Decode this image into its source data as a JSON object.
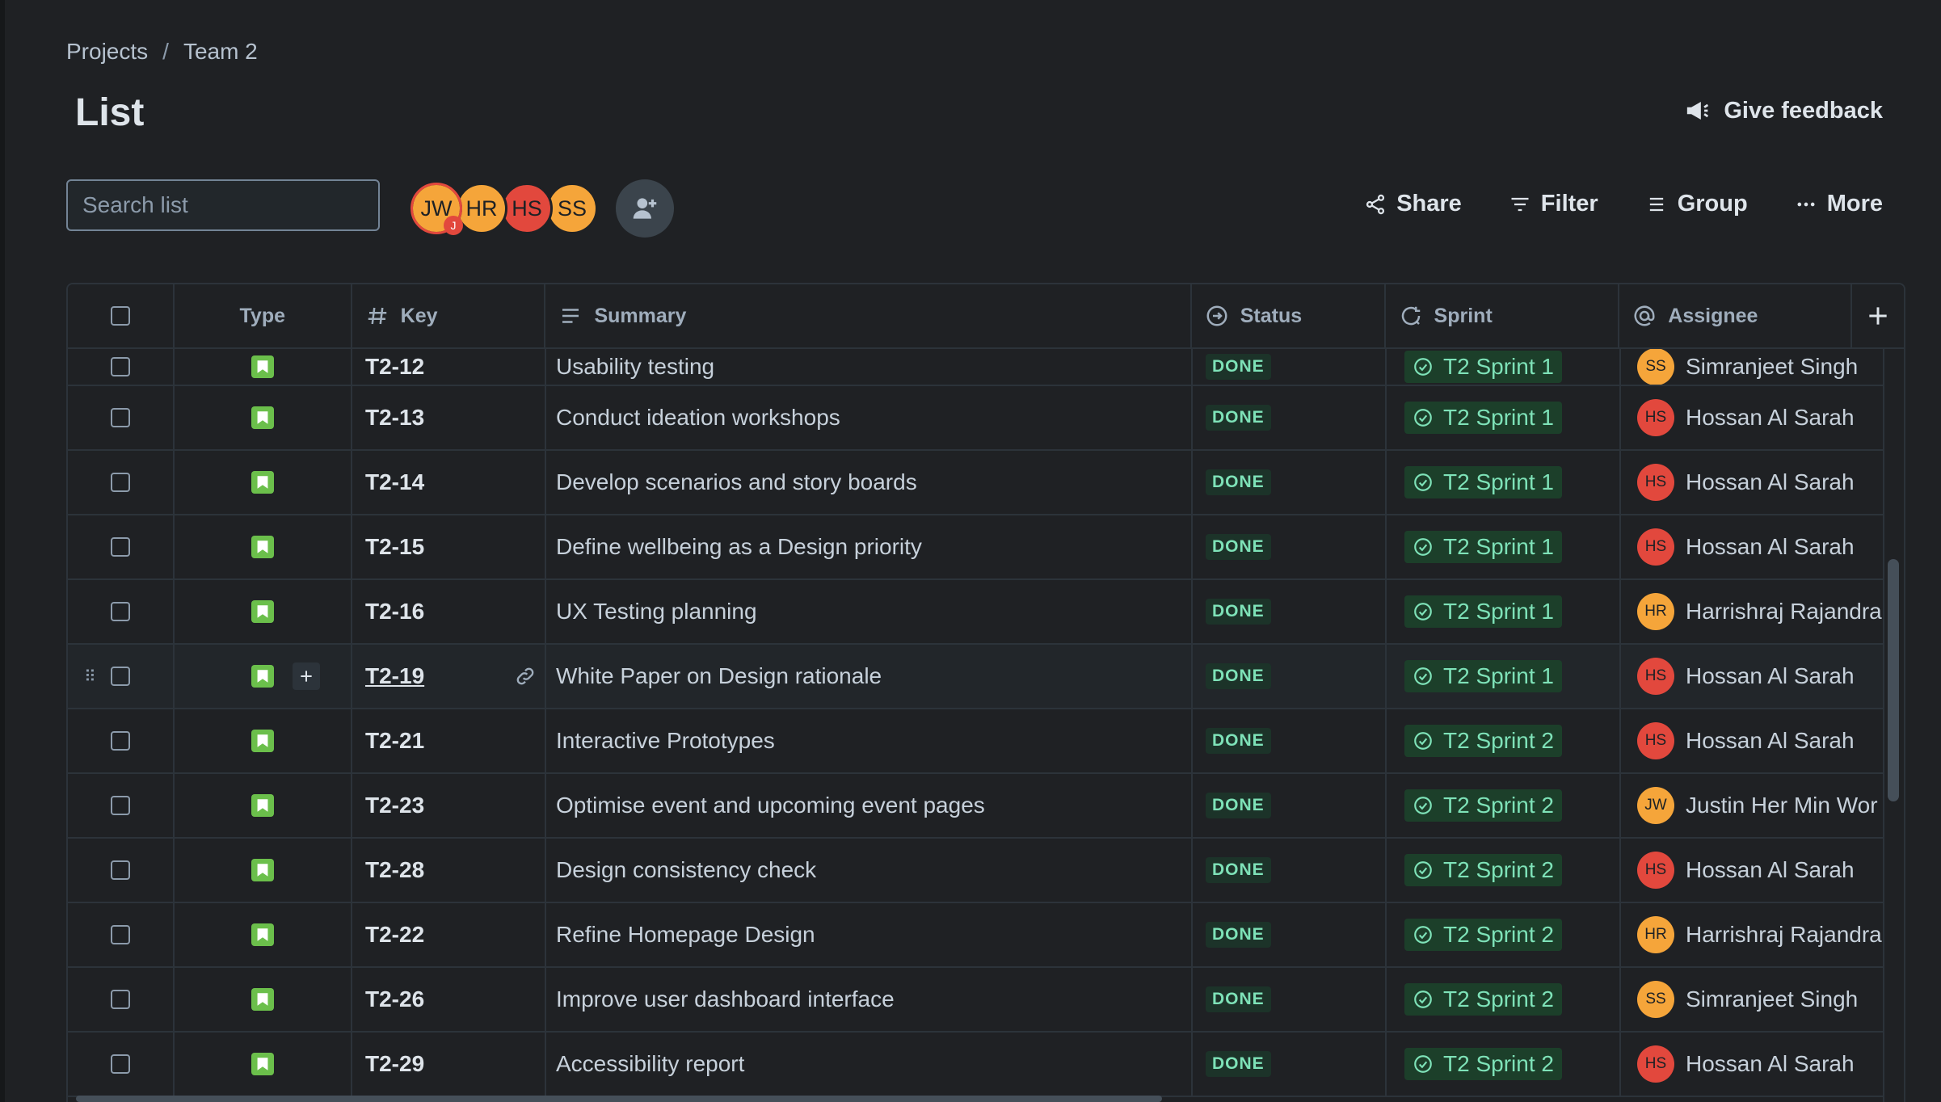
{
  "breadcrumb": {
    "items": [
      "Projects",
      "Team 2"
    ],
    "separator": "/"
  },
  "page": {
    "title": "List"
  },
  "feedback": {
    "label": "Give feedback",
    "icon": "megaphone-icon"
  },
  "search": {
    "placeholder": "Search list"
  },
  "avatars": [
    {
      "initials": "JW",
      "color": "#f5a53a",
      "badge": "J"
    },
    {
      "initials": "HR",
      "color": "#f5a53a"
    },
    {
      "initials": "HS",
      "color": "#e2483d"
    },
    {
      "initials": "SS",
      "color": "#f5a53a"
    }
  ],
  "toolbar": {
    "share": "Share",
    "filter": "Filter",
    "group": "Group",
    "more": "More"
  },
  "columns": {
    "type": "Type",
    "key": "Key",
    "summary": "Summary",
    "status": "Status",
    "sprint": "Sprint",
    "assignee": "Assignee"
  },
  "colors": {
    "status_bg": "#1c3329",
    "status_text": "#7ee2b8",
    "sprint_bg": "#1c3f2a",
    "type_story": "#6bbf4b",
    "avatar_orange": "#f5a53a",
    "avatar_red": "#e2483d"
  },
  "rows": [
    {
      "key": "T2-12",
      "summary": "Usability testing",
      "status": "DONE",
      "sprint": "T2 Sprint 1",
      "assignee": "Simranjeet Singh",
      "initials": "SS",
      "color": "#f5a53a"
    },
    {
      "key": "T2-13",
      "summary": "Conduct ideation workshops",
      "status": "DONE",
      "sprint": "T2 Sprint 1",
      "assignee": "Hossan Al Sarah",
      "initials": "HS",
      "color": "#e2483d"
    },
    {
      "key": "T2-14",
      "summary": "Develop scenarios and story boards",
      "status": "DONE",
      "sprint": "T2 Sprint 1",
      "assignee": "Hossan Al Sarah",
      "initials": "HS",
      "color": "#e2483d"
    },
    {
      "key": "T2-15",
      "summary": "Define wellbeing as a Design priority",
      "status": "DONE",
      "sprint": "T2 Sprint 1",
      "assignee": "Hossan Al Sarah",
      "initials": "HS",
      "color": "#e2483d"
    },
    {
      "key": "T2-16",
      "summary": "UX Testing planning",
      "status": "DONE",
      "sprint": "T2 Sprint 1",
      "assignee": "Harrishraj Rajandra",
      "initials": "HR",
      "color": "#f5a53a"
    },
    {
      "key": "T2-19",
      "summary": "White Paper on Design rationale",
      "status": "DONE",
      "sprint": "T2 Sprint 1",
      "assignee": "Hossan Al Sarah",
      "initials": "HS",
      "color": "#e2483d"
    },
    {
      "key": "T2-21",
      "summary": "Interactive Prototypes",
      "status": "DONE",
      "sprint": "T2 Sprint 2",
      "assignee": "Hossan Al Sarah",
      "initials": "HS",
      "color": "#e2483d"
    },
    {
      "key": "T2-23",
      "summary": "Optimise event and upcoming event pages",
      "status": "DONE",
      "sprint": "T2 Sprint 2",
      "assignee": "Justin Her Min Wor",
      "initials": "JW",
      "color": "#f5a53a"
    },
    {
      "key": "T2-28",
      "summary": "Design consistency check",
      "status": "DONE",
      "sprint": "T2 Sprint 2",
      "assignee": "Hossan Al Sarah",
      "initials": "HS",
      "color": "#e2483d"
    },
    {
      "key": "T2-22",
      "summary": "Refine Homepage Design",
      "status": "DONE",
      "sprint": "T2 Sprint 2",
      "assignee": "Harrishraj Rajandra",
      "initials": "HR",
      "color": "#f5a53a"
    },
    {
      "key": "T2-26",
      "summary": "Improve user dashboard interface",
      "status": "DONE",
      "sprint": "T2 Sprint 2",
      "assignee": "Simranjeet Singh",
      "initials": "SS",
      "color": "#f5a53a"
    },
    {
      "key": "T2-29",
      "summary": "Accessibility report",
      "status": "DONE",
      "sprint": "T2 Sprint 2",
      "assignee": "Hossan Al Sarah",
      "initials": "HS",
      "color": "#e2483d"
    }
  ]
}
